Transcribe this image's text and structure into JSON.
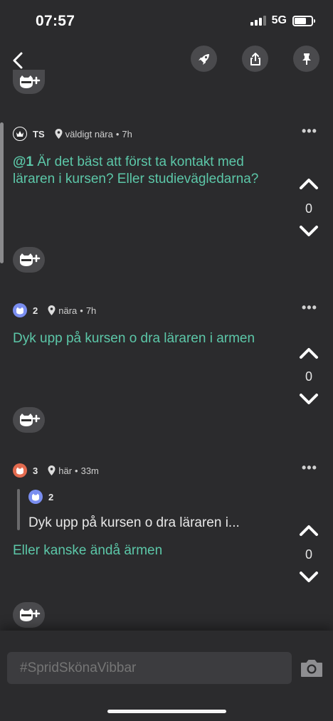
{
  "status": {
    "time": "07:57",
    "network": "5G"
  },
  "posts": [
    {
      "author": "TS",
      "distance": "väldigt nära",
      "age": "7h",
      "mention": "@1",
      "text": " Är det bäst att först ta kontakt med läraren i kursen? Eller studievägledarna?",
      "votes": "0"
    },
    {
      "author": "2",
      "distance": "nära",
      "age": "7h",
      "text": "Dyk upp på kursen o dra läraren i armen",
      "votes": "0"
    },
    {
      "author": "3",
      "distance": "här",
      "age": "33m",
      "quote_author": "2",
      "quote_text": "Dyk upp på kursen o dra läraren i...",
      "text": "Eller kanske ändå ärmen",
      "votes": "0"
    }
  ],
  "composer": {
    "placeholder": "#SpridSkönaVibbar"
  },
  "colors": {
    "accent_text": "#5cc7a8",
    "background": "#2b2b2d",
    "chip": "#4a4a4d"
  },
  "icons": [
    "back-icon",
    "rocket-icon",
    "share-icon",
    "pin-icon",
    "crown-icon",
    "location-icon",
    "more-icon",
    "upvote-icon",
    "downvote-icon",
    "cat-add-icon",
    "camera-icon"
  ]
}
